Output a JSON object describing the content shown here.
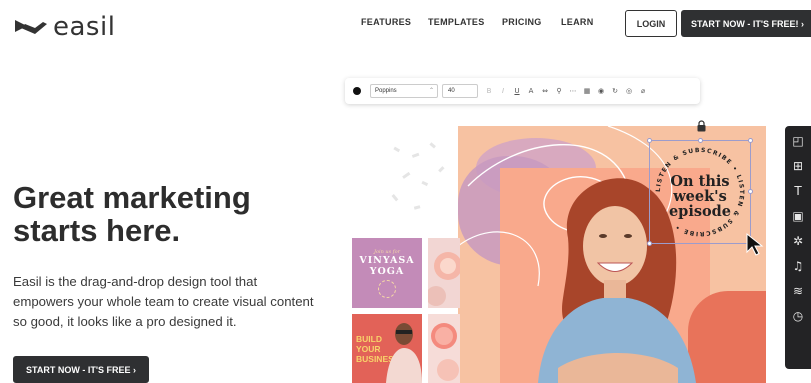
{
  "logo": {
    "text": "easil",
    "icon": "easil-logo-mark"
  },
  "nav": {
    "features": "FEATURES",
    "templates": "TEMPLATES",
    "pricing": "PRICING",
    "learn": "LEARN"
  },
  "header": {
    "login_label": "LOGIN",
    "start_label": "START NOW - IT'S FREE! ›"
  },
  "hero": {
    "title": "Great marketing starts here.",
    "description": "Easil is the drag-and-drop design tool that empowers your whole team to create visual content so good, it looks like a pro designed it.",
    "cta_label": "START NOW - IT'S FREE ›"
  },
  "toolbar": {
    "font": "Poppins",
    "size": "40",
    "icons": [
      "bold-icon",
      "italic-icon",
      "underline-icon",
      "text-color-icon",
      "spacing-icon",
      "person-icon",
      "more-icon",
      "grid-icon",
      "circle-icon",
      "rotate-icon",
      "layers-icon",
      "link-icon"
    ]
  },
  "canvas": {
    "badge_circle_text": "LISTEN & SUBSCRIBE • LISTEN & SUBSCRIBE •",
    "badge_line1": "On this",
    "badge_line2": "week's",
    "badge_line3": "episode",
    "colors": {
      "background": "#f7c2a2",
      "accent_red": "#e8735a",
      "accent_pink": "#c89abf"
    }
  },
  "side_panel": {
    "icons": [
      "sticker-icon",
      "layout-icon",
      "text-icon",
      "image-icon",
      "shapes-icon",
      "music-icon",
      "layers-icon",
      "timer-icon"
    ]
  },
  "thumbnails": {
    "yoga_small": "Join us for",
    "yoga_title1": "VINYASA",
    "yoga_title2": "YOGA",
    "business_line1": "BUILD",
    "business_line2": "YOUR",
    "business_line3": "BUSINESS"
  }
}
